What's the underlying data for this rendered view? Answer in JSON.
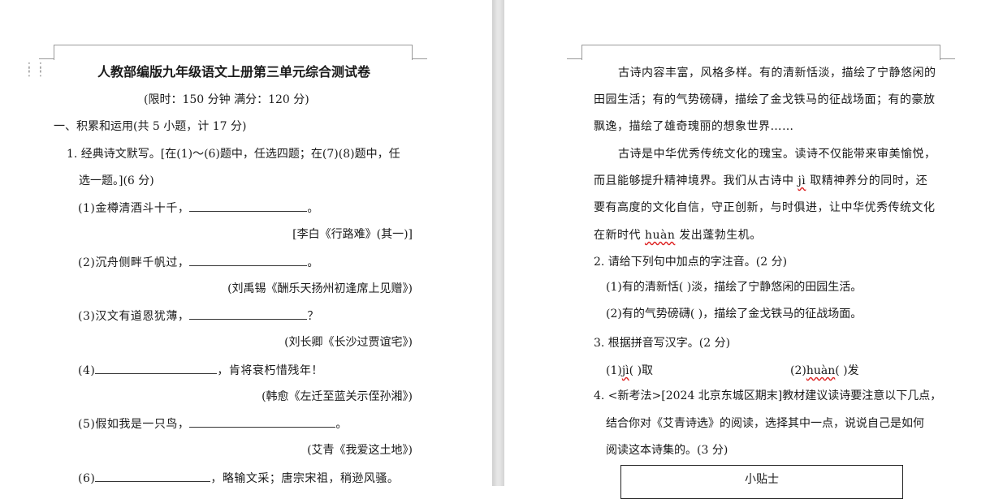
{
  "left": {
    "title": "人教部编版九年级语文上册第三单元综合测试卷",
    "meta": "(限时：150 分钟      满分：120 分)",
    "section1": "一、积累和运用(共 5  小题，计 17 分)",
    "q1_line1": "1. 经典诗文默写。[在(1)～(6)题中，任选四题；在(7)(8)题中，任",
    "q1_line2": "选一题。](6 分)",
    "items": [
      {
        "pre": "(1)金樽清酒斗十千，",
        "post": "。",
        "src": "[李白《行路难》(其一)]"
      },
      {
        "pre": "(2)沉舟侧畔千帆过，",
        "post": "。",
        "src": "(刘禹锡《酬乐天扬州初逢席上见赠》)"
      },
      {
        "pre": "(3)汉文有道恩犹薄，",
        "post": "？",
        "src": "(刘长卿《长沙过贾谊宅》)"
      },
      {
        "pre": "(4)",
        "post": "，肯将衰朽惜残年！",
        "src": "(韩愈《左迁至蓝关示侄孙湘》)"
      },
      {
        "pre": "(5)假如我是一只鸟，",
        "post": "。",
        "src": "(艾青《我爱这土地》)"
      },
      {
        "pre": "(6)",
        "post": "，略输文采；唐宗宋祖，稍逊风骚。",
        "src": ""
      }
    ]
  },
  "right": {
    "p1_l1": "古诗内容丰富，风格多样。有的清新恬淡，描绘了宁静悠闲的",
    "p1_l2": "田园生活；有的气势磅礴，描绘了金戈铁马的征战场面；有的豪放",
    "p1_l3": "飘逸，描绘了雄奇瑰丽的想象世界……",
    "p2_l1": "古诗是中华优秀传统文化的瑰宝。读诗不仅能带来审美愉悦，",
    "p2_l2a": "而且能够提升精神境界。我们从古诗中 ",
    "p2_l2_pinyin": "jì",
    "p2_l2b": " 取精神养分的同时，还",
    "p2_l3": "要有高度的文化自信，守正创新，与时俱进，让中华优秀传统文化",
    "p2_l4a": "在新时代 ",
    "p2_l4_pinyin": "huàn",
    "p2_l4b": " 发出蓬勃生机。",
    "q2": "2. 请给下列句中加点的字注音。(2 分)",
    "q2_1": "(1)有的清新恬(          )淡，描绘了宁静悠闲的田园生活。",
    "q2_2": "(2)有的气势磅礴(          )，描绘了金戈铁马的征战场面。",
    "q3": "3. 根据拼音写汉字。(2 分)",
    "q3_1a": "(1)",
    "q3_1_pinyin": "jì",
    "q3_1b": "(          )取",
    "q3_2a": "(2)",
    "q3_2_pinyin": "huàn",
    "q3_2b": "(          )发",
    "q4_l1": "4. <新考法>[2024 北京东城区期末]教材建议读诗要注意以下几点，",
    "q4_l2": "结合你对《艾青诗选》的阅读，选择其中一点，说说自己是如何",
    "q4_l3": "阅读这本诗集的。(3 分)",
    "tips_title": "小贴士"
  }
}
